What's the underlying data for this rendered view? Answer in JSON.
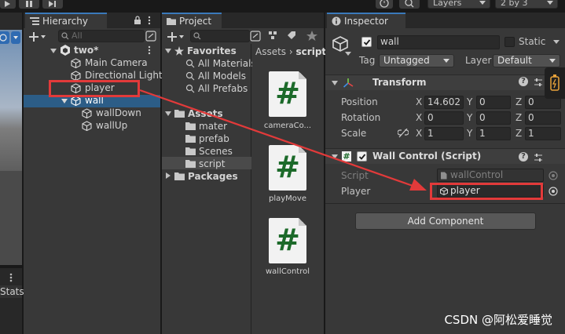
{
  "toolbar": {
    "layers_label": "Layers",
    "layout_label": "2 by 3"
  },
  "hierarchy": {
    "tab_label": "Hierarchy",
    "search_placeholder": "All",
    "scene_name": "two*",
    "items": [
      {
        "label": "Main Camera"
      },
      {
        "label": "Directional Light"
      },
      {
        "label": "player"
      },
      {
        "label": "wall"
      },
      {
        "label": "wallDown"
      },
      {
        "label": "wallUp"
      }
    ]
  },
  "scene_view": {
    "stats_label": "Stats"
  },
  "project": {
    "tab_label": "Project",
    "favorites_label": "Favorites",
    "favorites": [
      {
        "label": "All Materials"
      },
      {
        "label": "All Models"
      },
      {
        "label": "All Prefabs"
      }
    ],
    "assets_label": "Assets",
    "folders": [
      {
        "label": "mater"
      },
      {
        "label": "prefab"
      },
      {
        "label": "Scenes"
      },
      {
        "label": "script"
      }
    ],
    "packages_label": "Packages",
    "breadcrumb": {
      "root": "Assets",
      "arrow": "›",
      "current": "script"
    },
    "files": [
      {
        "label": "cameraCo...",
        "glyph": "#"
      },
      {
        "label": "playMove",
        "glyph": "#"
      },
      {
        "label": "wallControl",
        "glyph": "#"
      }
    ]
  },
  "inspector": {
    "tab_label": "Inspector",
    "object_name": "wall",
    "static_label": "Static",
    "tag_label": "Tag",
    "tag_value": "Untagged",
    "layer_label": "Layer",
    "layer_value": "Default",
    "transform": {
      "title": "Transform",
      "position_label": "Position",
      "rotation_label": "Rotation",
      "scale_label": "Scale",
      "x_label": "X",
      "y_label": "Y",
      "z_label": "Z",
      "position": {
        "x": "14.602",
        "y": "0",
        "z": "0"
      },
      "rotation": {
        "x": "0",
        "y": "0",
        "z": "0"
      },
      "scale": {
        "x": "1",
        "y": "1",
        "z": "1"
      }
    },
    "script_component": {
      "title": "Wall Control (Script)",
      "script_label": "Script",
      "script_value": "wallControl",
      "player_label": "Player",
      "player_value": "player"
    },
    "add_component_label": "Add Component",
    "help_glyph": "?"
  },
  "watermark": "CSDN @阿松爱睡觉",
  "colors": {
    "selection": "#2c5d87",
    "annotation_red": "#e23a3a",
    "hash_green": "#1c6a2a",
    "tab_accent": "#3a79bb"
  }
}
